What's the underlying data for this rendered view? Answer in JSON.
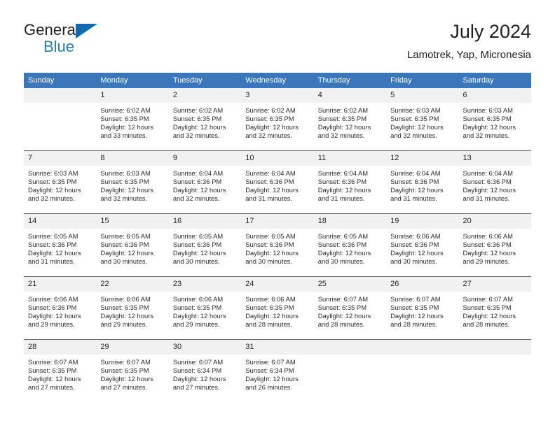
{
  "brand": {
    "name_part1": "General",
    "name_part2": "Blue",
    "triangle_color": "#1169b0",
    "blue_color": "#1b7fc4"
  },
  "header": {
    "title": "July 2024",
    "subtitle": "Lamotrek, Yap, Micronesia"
  },
  "theme": {
    "header_bg": "#3a76bc",
    "daynum_bg": "#f1f1f1",
    "row_divider": "#2e6db4",
    "text": "#231f20"
  },
  "weekdays": [
    "Sunday",
    "Monday",
    "Tuesday",
    "Wednesday",
    "Thursday",
    "Friday",
    "Saturday"
  ],
  "weeks": [
    [
      {
        "day": "",
        "sunrise": "",
        "sunset": "",
        "daylight_line1": "",
        "daylight_line2": ""
      },
      {
        "day": "1",
        "sunrise": "Sunrise: 6:02 AM",
        "sunset": "Sunset: 6:35 PM",
        "daylight_line1": "Daylight: 12 hours",
        "daylight_line2": "and 33 minutes."
      },
      {
        "day": "2",
        "sunrise": "Sunrise: 6:02 AM",
        "sunset": "Sunset: 6:35 PM",
        "daylight_line1": "Daylight: 12 hours",
        "daylight_line2": "and 32 minutes."
      },
      {
        "day": "3",
        "sunrise": "Sunrise: 6:02 AM",
        "sunset": "Sunset: 6:35 PM",
        "daylight_line1": "Daylight: 12 hours",
        "daylight_line2": "and 32 minutes."
      },
      {
        "day": "4",
        "sunrise": "Sunrise: 6:02 AM",
        "sunset": "Sunset: 6:35 PM",
        "daylight_line1": "Daylight: 12 hours",
        "daylight_line2": "and 32 minutes."
      },
      {
        "day": "5",
        "sunrise": "Sunrise: 6:03 AM",
        "sunset": "Sunset: 6:35 PM",
        "daylight_line1": "Daylight: 12 hours",
        "daylight_line2": "and 32 minutes."
      },
      {
        "day": "6",
        "sunrise": "Sunrise: 6:03 AM",
        "sunset": "Sunset: 6:35 PM",
        "daylight_line1": "Daylight: 12 hours",
        "daylight_line2": "and 32 minutes."
      }
    ],
    [
      {
        "day": "7",
        "sunrise": "Sunrise: 6:03 AM",
        "sunset": "Sunset: 6:35 PM",
        "daylight_line1": "Daylight: 12 hours",
        "daylight_line2": "and 32 minutes."
      },
      {
        "day": "8",
        "sunrise": "Sunrise: 6:03 AM",
        "sunset": "Sunset: 6:35 PM",
        "daylight_line1": "Daylight: 12 hours",
        "daylight_line2": "and 32 minutes."
      },
      {
        "day": "9",
        "sunrise": "Sunrise: 6:04 AM",
        "sunset": "Sunset: 6:36 PM",
        "daylight_line1": "Daylight: 12 hours",
        "daylight_line2": "and 32 minutes."
      },
      {
        "day": "10",
        "sunrise": "Sunrise: 6:04 AM",
        "sunset": "Sunset: 6:36 PM",
        "daylight_line1": "Daylight: 12 hours",
        "daylight_line2": "and 31 minutes."
      },
      {
        "day": "11",
        "sunrise": "Sunrise: 6:04 AM",
        "sunset": "Sunset: 6:36 PM",
        "daylight_line1": "Daylight: 12 hours",
        "daylight_line2": "and 31 minutes."
      },
      {
        "day": "12",
        "sunrise": "Sunrise: 6:04 AM",
        "sunset": "Sunset: 6:36 PM",
        "daylight_line1": "Daylight: 12 hours",
        "daylight_line2": "and 31 minutes."
      },
      {
        "day": "13",
        "sunrise": "Sunrise: 6:04 AM",
        "sunset": "Sunset: 6:36 PM",
        "daylight_line1": "Daylight: 12 hours",
        "daylight_line2": "and 31 minutes."
      }
    ],
    [
      {
        "day": "14",
        "sunrise": "Sunrise: 6:05 AM",
        "sunset": "Sunset: 6:36 PM",
        "daylight_line1": "Daylight: 12 hours",
        "daylight_line2": "and 31 minutes."
      },
      {
        "day": "15",
        "sunrise": "Sunrise: 6:05 AM",
        "sunset": "Sunset: 6:36 PM",
        "daylight_line1": "Daylight: 12 hours",
        "daylight_line2": "and 30 minutes."
      },
      {
        "day": "16",
        "sunrise": "Sunrise: 6:05 AM",
        "sunset": "Sunset: 6:36 PM",
        "daylight_line1": "Daylight: 12 hours",
        "daylight_line2": "and 30 minutes."
      },
      {
        "day": "17",
        "sunrise": "Sunrise: 6:05 AM",
        "sunset": "Sunset: 6:36 PM",
        "daylight_line1": "Daylight: 12 hours",
        "daylight_line2": "and 30 minutes."
      },
      {
        "day": "18",
        "sunrise": "Sunrise: 6:05 AM",
        "sunset": "Sunset: 6:36 PM",
        "daylight_line1": "Daylight: 12 hours",
        "daylight_line2": "and 30 minutes."
      },
      {
        "day": "19",
        "sunrise": "Sunrise: 6:06 AM",
        "sunset": "Sunset: 6:36 PM",
        "daylight_line1": "Daylight: 12 hours",
        "daylight_line2": "and 30 minutes."
      },
      {
        "day": "20",
        "sunrise": "Sunrise: 6:06 AM",
        "sunset": "Sunset: 6:36 PM",
        "daylight_line1": "Daylight: 12 hours",
        "daylight_line2": "and 29 minutes."
      }
    ],
    [
      {
        "day": "21",
        "sunrise": "Sunrise: 6:06 AM",
        "sunset": "Sunset: 6:36 PM",
        "daylight_line1": "Daylight: 12 hours",
        "daylight_line2": "and 29 minutes."
      },
      {
        "day": "22",
        "sunrise": "Sunrise: 6:06 AM",
        "sunset": "Sunset: 6:35 PM",
        "daylight_line1": "Daylight: 12 hours",
        "daylight_line2": "and 29 minutes."
      },
      {
        "day": "23",
        "sunrise": "Sunrise: 6:06 AM",
        "sunset": "Sunset: 6:35 PM",
        "daylight_line1": "Daylight: 12 hours",
        "daylight_line2": "and 29 minutes."
      },
      {
        "day": "24",
        "sunrise": "Sunrise: 6:06 AM",
        "sunset": "Sunset: 6:35 PM",
        "daylight_line1": "Daylight: 12 hours",
        "daylight_line2": "and 28 minutes."
      },
      {
        "day": "25",
        "sunrise": "Sunrise: 6:07 AM",
        "sunset": "Sunset: 6:35 PM",
        "daylight_line1": "Daylight: 12 hours",
        "daylight_line2": "and 28 minutes."
      },
      {
        "day": "26",
        "sunrise": "Sunrise: 6:07 AM",
        "sunset": "Sunset: 6:35 PM",
        "daylight_line1": "Daylight: 12 hours",
        "daylight_line2": "and 28 minutes."
      },
      {
        "day": "27",
        "sunrise": "Sunrise: 6:07 AM",
        "sunset": "Sunset: 6:35 PM",
        "daylight_line1": "Daylight: 12 hours",
        "daylight_line2": "and 28 minutes."
      }
    ],
    [
      {
        "day": "28",
        "sunrise": "Sunrise: 6:07 AM",
        "sunset": "Sunset: 6:35 PM",
        "daylight_line1": "Daylight: 12 hours",
        "daylight_line2": "and 27 minutes."
      },
      {
        "day": "29",
        "sunrise": "Sunrise: 6:07 AM",
        "sunset": "Sunset: 6:35 PM",
        "daylight_line1": "Daylight: 12 hours",
        "daylight_line2": "and 27 minutes."
      },
      {
        "day": "30",
        "sunrise": "Sunrise: 6:07 AM",
        "sunset": "Sunset: 6:34 PM",
        "daylight_line1": "Daylight: 12 hours",
        "daylight_line2": "and 27 minutes."
      },
      {
        "day": "31",
        "sunrise": "Sunrise: 6:07 AM",
        "sunset": "Sunset: 6:34 PM",
        "daylight_line1": "Daylight: 12 hours",
        "daylight_line2": "and 26 minutes."
      },
      {
        "day": "",
        "sunrise": "",
        "sunset": "",
        "daylight_line1": "",
        "daylight_line2": ""
      },
      {
        "day": "",
        "sunrise": "",
        "sunset": "",
        "daylight_line1": "",
        "daylight_line2": ""
      },
      {
        "day": "",
        "sunrise": "",
        "sunset": "",
        "daylight_line1": "",
        "daylight_line2": ""
      }
    ]
  ]
}
